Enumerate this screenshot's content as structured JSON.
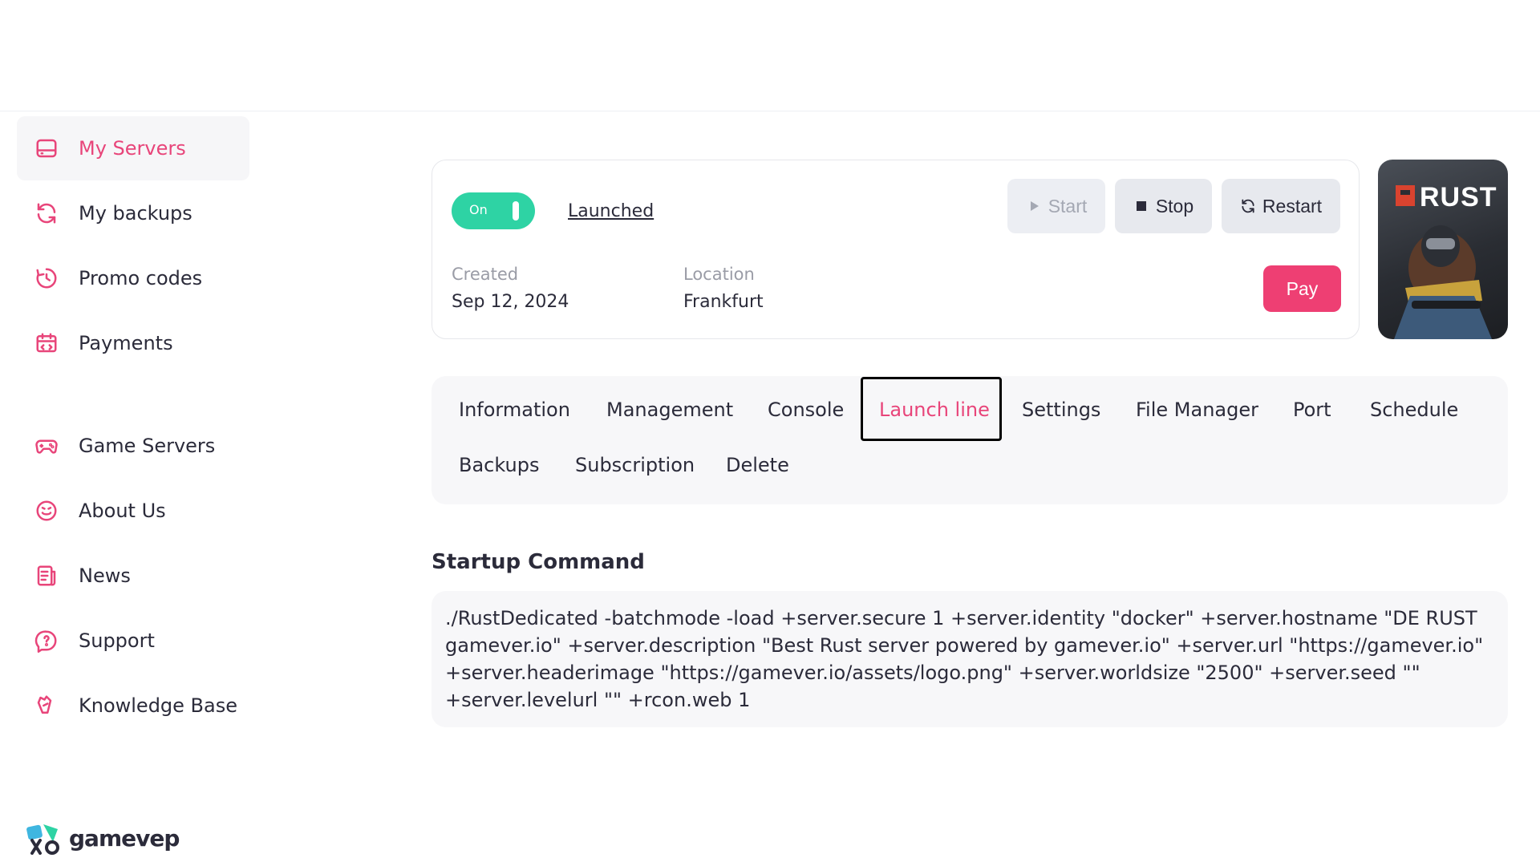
{
  "sidebar": {
    "items": [
      {
        "label": "My Servers",
        "icon": "server-icon",
        "active": true
      },
      {
        "label": "My backups",
        "icon": "refresh-icon"
      },
      {
        "label": "Promo codes",
        "icon": "promo-icon"
      },
      {
        "label": "Payments",
        "icon": "payments-icon"
      },
      {
        "label": "Game Servers",
        "icon": "gamepad-icon"
      },
      {
        "label": "About Us",
        "icon": "smile-icon"
      },
      {
        "label": "News",
        "icon": "news-icon"
      },
      {
        "label": "Support",
        "icon": "support-icon"
      },
      {
        "label": "Knowledge Base",
        "icon": "knowledge-icon"
      }
    ],
    "logo_text": "gamevep"
  },
  "server": {
    "toggle_label": "On",
    "status": "Launched",
    "created_label": "Created",
    "created_value": "Sep 12, 2024",
    "location_label": "Location",
    "location_value": "Frankfurt",
    "buttons": {
      "start": "Start",
      "stop": "Stop",
      "restart": "Restart",
      "pay": "Pay"
    },
    "game_cover_text": "RUST"
  },
  "tabs": [
    {
      "label": "Information"
    },
    {
      "label": "Management"
    },
    {
      "label": "Console"
    },
    {
      "label": "Launch line",
      "active": true
    },
    {
      "label": "Settings"
    },
    {
      "label": "File Manager"
    },
    {
      "label": "Port"
    },
    {
      "label": "Schedule"
    },
    {
      "label": "Backups"
    },
    {
      "label": "Subscription"
    },
    {
      "label": "Delete"
    }
  ],
  "startup": {
    "title": "Startup Command",
    "command": "./RustDedicated -batchmode -load +server.secure 1 +server.identity \"docker\" +server.hostname \"DE RUST gamever.io\" +server.description \"Best Rust server powered by gamever.io\" +server.url \"https://gamever.io\" +server.headerimage \"https://gamever.io/assets/logo.png\" +server.worldsize \"2500\" +server.seed \"\" +server.levelurl \"\" +rcon.web 1"
  },
  "colors": {
    "accent": "#e8457a",
    "toggle_on": "#2ed3a4",
    "pay": "#ee3f73"
  }
}
